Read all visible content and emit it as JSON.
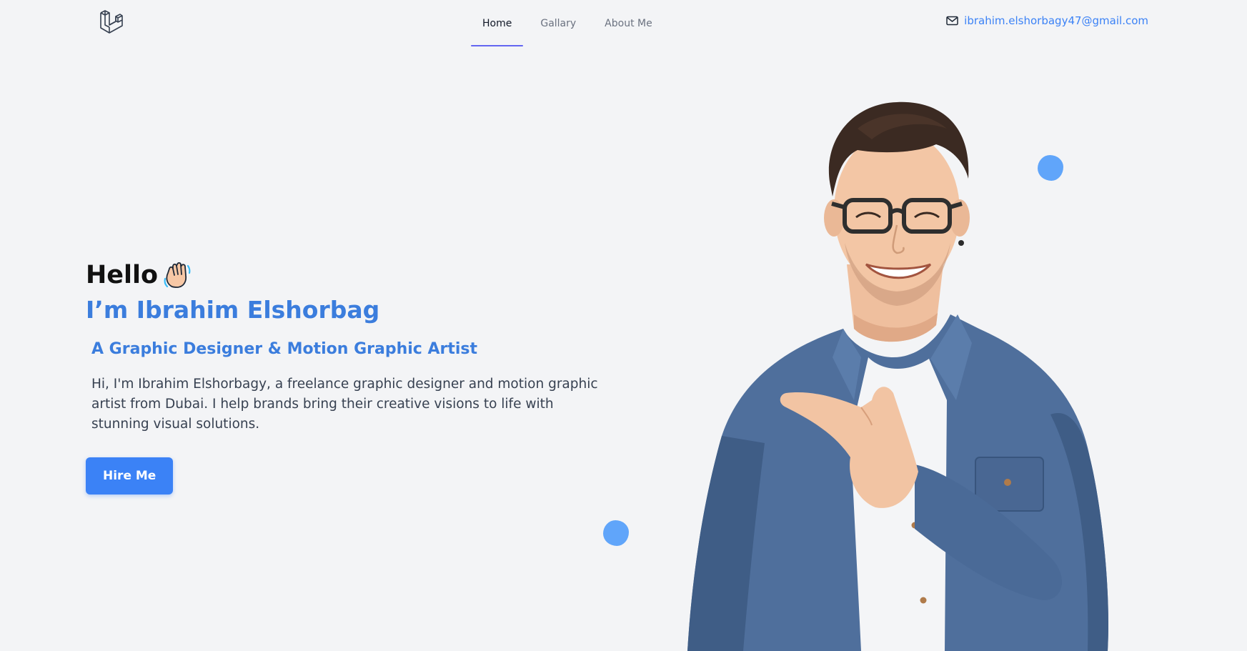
{
  "nav": {
    "links": [
      {
        "label": "Home",
        "active": true
      },
      {
        "label": "Gallary",
        "active": false
      },
      {
        "label": "About Me",
        "active": false
      }
    ],
    "email": "ibrahim.elshorbagy47@gmail.com",
    "icons": {
      "logo": "laravel-logo",
      "mail": "mail-icon"
    }
  },
  "hero": {
    "greeting": "Hello",
    "greeting_icon": "waving-hand-icon",
    "name": "I’m Ibrahim Elshorbag",
    "role": "A Graphic Designer & Motion Graphic Artist",
    "bio": "Hi, I'm Ibrahim Elshorbagy, a freelance graphic designer and motion graphic artist from Dubai. I help brands bring their creative visions to life with stunning visual solutions.",
    "cta_label": "Hire Me"
  },
  "colors": {
    "background": "#f3f4f6",
    "accent": "#3b82f6",
    "heading_blue": "#3b7ddd",
    "nav_underline": "#6366f1",
    "blob": "#60a5fa"
  }
}
